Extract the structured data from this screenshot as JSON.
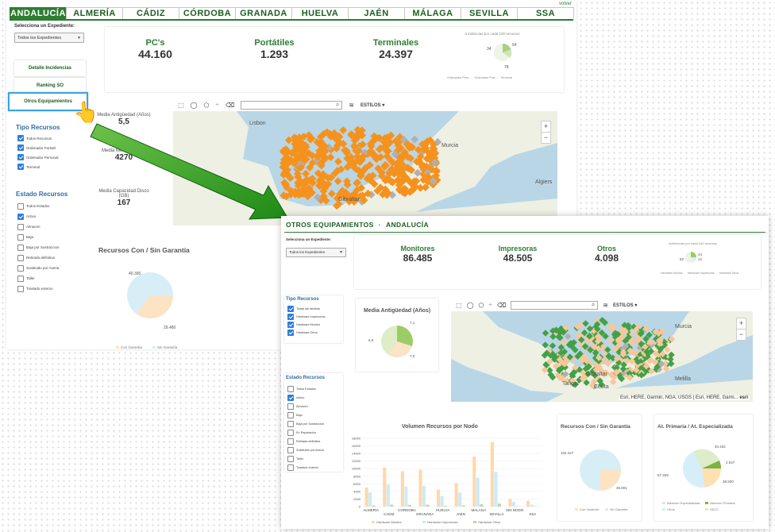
{
  "back": {
    "volver": "volver",
    "tabs": [
      {
        "label": "ANDALUCÍA",
        "active": true
      },
      {
        "label": "ALMERÍA"
      },
      {
        "label": "CÁDIZ"
      },
      {
        "label": "CÓRDOBA"
      },
      {
        "label": "GRANADA"
      },
      {
        "label": "HUELVA"
      },
      {
        "label": "JAÉN"
      },
      {
        "label": "MÁLAGA"
      },
      {
        "label": "SEVILLA"
      },
      {
        "label": "SSA"
      }
    ],
    "select_label": "Selecciona un Expediente:",
    "select_value": "Todos los Expedientes",
    "nav": {
      "detalle": "Detalle Incidencias",
      "ranking": "Ranking SO",
      "otros": "Otros Equipamientos"
    },
    "kpis": [
      {
        "title": "PC's",
        "value": "44.160"
      },
      {
        "title": "Portátiles",
        "value": "1.293"
      },
      {
        "title": "Terminales",
        "value": "24.397"
      }
    ],
    "incidencias_title": "Incidencias por cada 100 recursos",
    "incidencias_pie": {
      "labels": [
        "34",
        "64",
        "78"
      ],
      "colors": [
        "#cfe6b8",
        "#eef4e6",
        "#a9cf8a"
      ]
    },
    "incidencias_legend": [
      "Ordenador Pers...",
      "Ordenador Port...",
      "Terminal"
    ],
    "tipo_title": "Tipo Recursos",
    "tipo_items": [
      {
        "label": "Todos Recursos",
        "checked": true
      },
      {
        "label": "Ordenador Portatil",
        "checked": true
      },
      {
        "label": "Ordenador Personal",
        "checked": true
      },
      {
        "label": "Terminal",
        "checked": true
      }
    ],
    "estado_title": "Estado Recursos",
    "estado_items": [
      {
        "label": "Todos Estados",
        "checked": false
      },
      {
        "label": "Activo",
        "checked": true
      },
      {
        "label": "Almacen",
        "checked": false
      },
      {
        "label": "Baja",
        "checked": false
      },
      {
        "label": "Baja por Sustraccion",
        "checked": false
      },
      {
        "label": "Retirada definitiva",
        "checked": false
      },
      {
        "label": "Sustituido por Averia",
        "checked": false
      },
      {
        "label": "Taller",
        "checked": false
      },
      {
        "label": "Traslado externo",
        "checked": false
      }
    ],
    "stats": [
      {
        "label": "Media Antigüedad (Años)",
        "value": "5,5"
      },
      {
        "label": "Media Memoria (MB)",
        "value": "4270"
      },
      {
        "label": "Media Capacidad Disco (GB)",
        "value": "167"
      }
    ],
    "map": {
      "estilos": "ESTILOS",
      "places": [
        "Lisbon",
        "Murcia",
        "Algiers",
        "Gibraltar"
      ],
      "zoom_in": "+",
      "zoom_out": "−",
      "fill": "#f5921e"
    },
    "garantia": {
      "title": "Recursos Con / Sin Garantía",
      "values": [
        "40.390",
        "29.480"
      ],
      "legend": [
        "Con Garantía",
        "Sin Garantía"
      ],
      "colors": [
        "#fce3c4",
        "#d8eef6"
      ]
    }
  },
  "front": {
    "title": "OTROS EQUIPAMIENTOS",
    "title2": "ANDALUCÍA",
    "select_label": "Selecciona un Expediente:",
    "select_value": "Todos los Expedientes",
    "kpis": [
      {
        "title": "Monitores",
        "value": "86.485"
      },
      {
        "title": "Impresoras",
        "value": "48.505"
      },
      {
        "title": "Otros",
        "value": "4.098"
      }
    ],
    "incidencias_title": "Incidencias por cada 100 recursos",
    "incidencias_pie": {
      "labels": [
        "82",
        "24",
        "12"
      ]
    },
    "incidencias_legend": [
      "Hardware Monitor",
      "Hardware Impresoras",
      "Hardware Otros"
    ],
    "tipo_title": "Tipo Recursos",
    "tipo_items": [
      {
        "label": "Todas las familias",
        "checked": true
      },
      {
        "label": "Hardware.Impresoras",
        "checked": true
      },
      {
        "label": "Hardware.Monitor",
        "checked": true
      },
      {
        "label": "Hardware.Otros",
        "checked": true
      }
    ],
    "estado_title": "Estado Recursos",
    "estado_items": [
      {
        "label": "Todos Estados",
        "checked": false
      },
      {
        "label": "Activo",
        "checked": true
      },
      {
        "label": "Almacen",
        "checked": false
      },
      {
        "label": "Baja",
        "checked": false
      },
      {
        "label": "Baja por Sustraccion",
        "checked": false
      },
      {
        "label": "En Reparación",
        "checked": false
      },
      {
        "label": "Retirada definitiva",
        "checked": false
      },
      {
        "label": "Sustituido por Averia",
        "checked": false
      },
      {
        "label": "Taller",
        "checked": false
      },
      {
        "label": "Traslado externo",
        "checked": false
      }
    ],
    "antig_title": "Media Antigüedad (Años)",
    "antig_labels": [
      "7,1",
      "6,9",
      "7,0"
    ],
    "map": {
      "estilos": "ESTILOS",
      "places": [
        "Murcia",
        "Gibraltar",
        "Ceuta",
        "Tanger",
        "Melilla"
      ],
      "attribution": "Esri, HERE, Garmin, NGA, USGS | Esri, HERE, Garm...",
      "esri": "esri",
      "zoom_in": "+",
      "zoom_out": "−"
    },
    "garantia": {
      "title": "Recursos Con / Sin Garantía",
      "values": [
        "102.427",
        "36.801"
      ],
      "legend": [
        "Con Garantía",
        "Sin Garantía"
      ]
    },
    "atencion": {
      "title": "At. Primaria / At. Especializada",
      "values": [
        "40.402",
        "2.547",
        "57.259",
        "38.930"
      ],
      "legend": [
        "Atencion Especializada",
        "Atención Primaria",
        "Otros",
        "SSCC"
      ],
      "colors": [
        "#dcedc8",
        "#7cb342",
        "#d6eef8",
        "#ffe0b2"
      ]
    }
  },
  "chart_data": {
    "type": "bar",
    "title": "Volumen Recursos por Nodo",
    "categories": [
      "ALMERIA",
      "CADIZ",
      "CORDOBA",
      "GRANADA",
      "HUELVA",
      "JAEN",
      "MALAGA",
      "SEVILLA",
      "SIN NODO",
      "SSA"
    ],
    "series": [
      {
        "name": "Hardware.Monitor",
        "color": "#ffd8a8",
        "values": [
          5000,
          10300,
          9300,
          9700,
          4500,
          6200,
          13200,
          17000,
          2000,
          1500
        ]
      },
      {
        "name": "Hardware.Impresoras",
        "color": "#cdeaf6",
        "values": [
          3700,
          5800,
          5300,
          5500,
          2800,
          3700,
          7600,
          9200,
          1200,
          500
        ]
      },
      {
        "name": "Hardware.Otros",
        "color": "#b6dca0",
        "values": [
          300,
          500,
          400,
          500,
          200,
          300,
          600,
          800,
          100,
          100
        ]
      }
    ],
    "yticks": [
      "0",
      "2000",
      "4000",
      "6000",
      "8000",
      "10000",
      "12000",
      "14000",
      "16000",
      "18000"
    ],
    "ylim": [
      0,
      18000
    ],
    "legend_position": "bottom"
  }
}
